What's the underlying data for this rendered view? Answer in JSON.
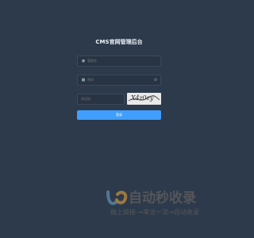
{
  "login": {
    "title": "CMS官网管理后台",
    "username_placeholder": "管理名",
    "password_placeholder": "密码",
    "captcha_placeholder": "验证码",
    "captcha_text": "X4z0ey",
    "submit_label": "登录"
  },
  "watermark": {
    "title": "自动秒收录",
    "subtitle": "做上链接 →来访一次→自动收录"
  },
  "colors": {
    "background": "#2d3a4b",
    "input_background": "#283443",
    "accent": "#409eff",
    "watermark_orange": "#e6a23c"
  }
}
